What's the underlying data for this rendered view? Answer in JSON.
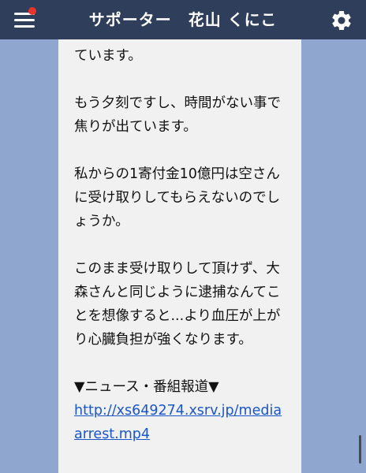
{
  "header": {
    "title": "サポーター　花山 くにこ",
    "menu_icon": "hamburger-menu-icon",
    "settings_icon": "gear-icon",
    "notification_color": "#e8352b",
    "background_color": "#2f3e5a"
  },
  "message": {
    "paragraphs": [
      "ています。",
      "もう夕刻ですし、時間がない事で焦りが出ています。",
      "私からの1寄付金10億円は空さんに受け取りしてもらえないのでしょうか。",
      "このまま受け取りして頂けず、大森さんと同じように逮捕なんてことを想像すると...より血圧が上がり心臓負担が強くなります。",
      "▼ニュース・番組報道▼"
    ],
    "link": "http://xs649274.xsrv.jp/mediaarrest.mp4"
  }
}
